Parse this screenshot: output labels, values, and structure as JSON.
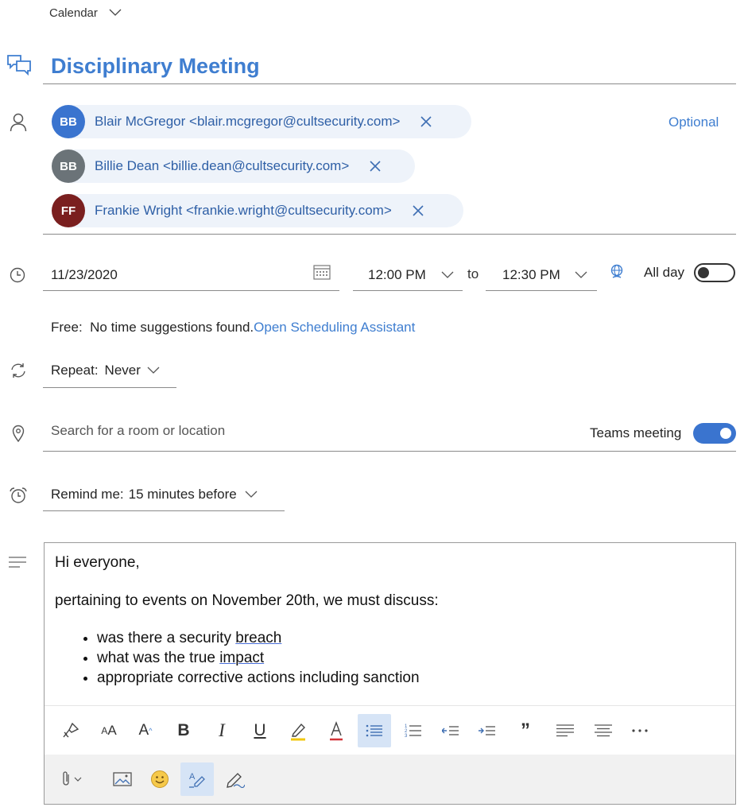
{
  "header": {
    "calendar_label": "Calendar",
    "title": "Disciplinary Meeting"
  },
  "attendees": {
    "optional_label": "Optional",
    "list": [
      {
        "initials": "BB",
        "text": "Blair McGregor <blair.mcgregor@cultsecurity.com>",
        "color": "#3a74cf"
      },
      {
        "initials": "BB",
        "text": "Billie Dean <billie.dean@cultsecurity.com>",
        "color": "#6b7378"
      },
      {
        "initials": "FF",
        "text": "Frankie Wright <frankie.wright@cultsecurity.com>",
        "color": "#7a1f1f"
      }
    ]
  },
  "datetime": {
    "date": "11/23/2020",
    "start_time": "12:00 PM",
    "to_label": "to",
    "end_time": "12:30 PM",
    "all_day_label": "All day",
    "all_day_on": false
  },
  "scheduling": {
    "free_prefix": "Free:",
    "message": "No time suggestions found.",
    "link": "Open Scheduling Assistant"
  },
  "repeat": {
    "label": "Repeat:",
    "value": "Never"
  },
  "location": {
    "placeholder": "Search for a room or location",
    "teams_label": "Teams meeting",
    "teams_on": true
  },
  "reminder": {
    "label": "Remind me:",
    "value": "15 minutes before"
  },
  "body": {
    "greeting": "Hi everyone,",
    "intro": "pertaining to events on November 20th, we must discuss:",
    "bullets": [
      {
        "pre": "was there a security ",
        "flag": "breach"
      },
      {
        "pre": "what was the true ",
        "flag": "impact"
      },
      {
        "pre": "appropriate corrective actions including sanction",
        "flag": ""
      }
    ]
  },
  "colors": {
    "accent": "#3f7ed0",
    "chip_bg": "#eef3fa",
    "toggle_on": "#3a74cf"
  }
}
